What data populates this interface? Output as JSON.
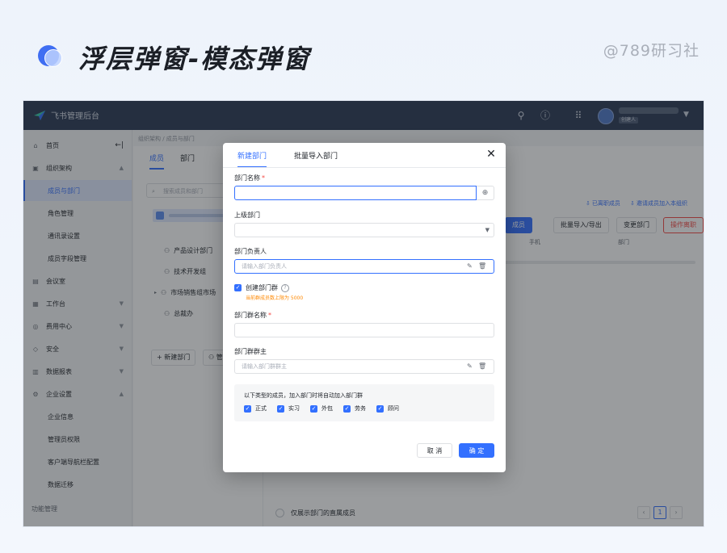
{
  "slide": {
    "title": "浮层弹窗-模态弹窗",
    "watermark": "@789研习社"
  },
  "app": {
    "name": "飞书管理后台",
    "user_role": "创建人"
  },
  "sidebar": {
    "items": [
      {
        "label": "首页",
        "icon": "home-icon"
      },
      {
        "label": "组织架构",
        "icon": "org-icon"
      },
      {
        "label": "成员与部门",
        "active": true
      },
      {
        "label": "角色管理"
      },
      {
        "label": "通讯录设置"
      },
      {
        "label": "成员字段管理"
      },
      {
        "label": "会议室",
        "icon": "meeting-room-icon"
      },
      {
        "label": "工作台",
        "icon": "workspace-icon"
      },
      {
        "label": "费用中心",
        "icon": "billing-icon"
      },
      {
        "label": "安全",
        "icon": "security-icon"
      },
      {
        "label": "数据报表",
        "icon": "report-icon"
      },
      {
        "label": "企业设置",
        "icon": "settings-icon"
      },
      {
        "label": "企业信息"
      },
      {
        "label": "管理员权限"
      },
      {
        "label": "客户端导航栏配置"
      },
      {
        "label": "数据迁移"
      },
      {
        "label": "功能管理"
      }
    ],
    "collapse_glyph": "←|"
  },
  "main": {
    "breadcrumb": "组织架构 / 成员与部门",
    "tabs": [
      "成员",
      "部门"
    ],
    "search_placeholder": "搜索成员和部门",
    "departments": [
      "产品设计部门",
      "技术开发组",
      "市场销售组市场",
      "总裁办"
    ],
    "new_dept_button": "+ 新建部门",
    "manage_button": "管",
    "links": [
      "⇩ 已离职成员",
      "⇩ 邀请成员加入本组织"
    ],
    "actions": {
      "add": "成员",
      "import_export": "批量导入/导出",
      "change_dept": "变更部门",
      "action_log": "操作离职"
    },
    "columns": [
      "手机",
      "部门"
    ],
    "only_direct_label": "仅展示部门的直属成员",
    "page_current": "1"
  },
  "modal": {
    "tabs": [
      "新建部门",
      "批量导入部门"
    ],
    "dept_name_label": "部门名称",
    "parent_label": "上级部门",
    "owner_label": "部门负责人",
    "owner_placeholder": "请输入部门负责人",
    "create_group_label": "创建部门群",
    "group_hint": "当前群成员数上限为 5000",
    "group_name_label": "部门群名称",
    "group_owner_label": "部门群群主",
    "group_owner_placeholder": "请输入部门群群主",
    "types_title": "以下类型的成员，加入部门时将自动加入部门群",
    "types": [
      "正式",
      "实习",
      "外包",
      "劳务",
      "顾问"
    ],
    "cancel": "取 消",
    "confirm": "确 定"
  },
  "colors": {
    "primary": "#3370ff",
    "topbar": "#2b3a55",
    "danger": "#f54a45",
    "hint": "#ff8800"
  }
}
